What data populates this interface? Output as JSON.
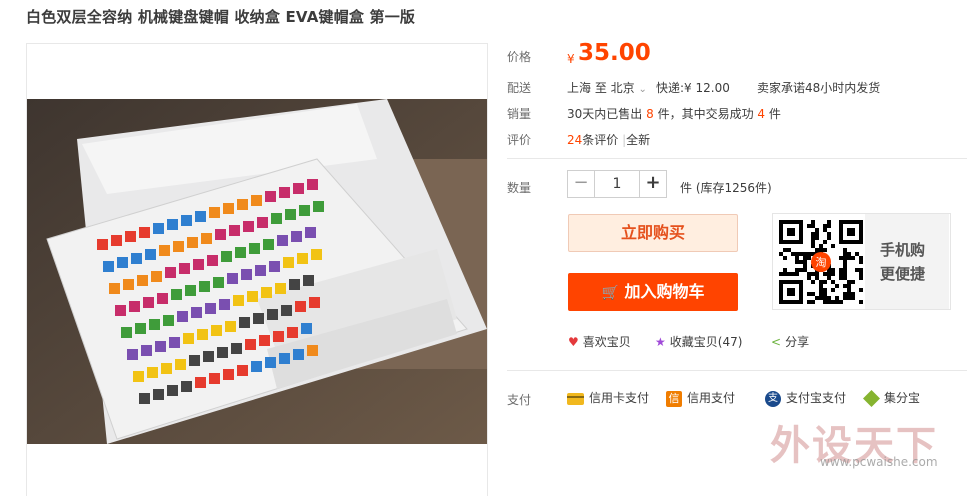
{
  "title": "白色双层全容纳 机械键盘键帽 收纳盒 EVA键帽盒 第一版",
  "price": {
    "label": "价格",
    "currency": "¥",
    "value": "35.00"
  },
  "delivery": {
    "label": "配送",
    "route": "上海 至 北京",
    "route_caret": "⌄",
    "shipping": "快递:¥ 12.00",
    "promise": "卖家承诺48小时内发货"
  },
  "sales": {
    "label": "销量",
    "prefix": "30天内已售出",
    "sold": "8",
    "mid": "件，其中交易成功",
    "success": "4",
    "suffix": "件"
  },
  "reviews": {
    "label": "评价",
    "count": "24",
    "count_suffix": "条评价",
    "divider": "|",
    "condition": "全新"
  },
  "quantity": {
    "label": "数量",
    "minus": "−",
    "value": "1",
    "plus": "+",
    "stock": "件 (库存1256件)"
  },
  "buttons": {
    "buy_now": "立即购买",
    "add_cart": "加入购物车",
    "cart_icon": "🛒"
  },
  "mobile": {
    "line1": "手机购",
    "line2": "更便捷",
    "qr_badge": "淘"
  },
  "actions": [
    {
      "name": "like",
      "icon": "♥",
      "icon_color": "#e4393c",
      "label": "喜欢宝贝"
    },
    {
      "name": "collect",
      "icon": "★",
      "icon_color": "#a04ad8",
      "label": "收藏宝贝(47)"
    },
    {
      "name": "share",
      "icon": "<",
      "icon_color": "#6cb33e",
      "label": "分享"
    }
  ],
  "payment": {
    "label": "支付",
    "items": [
      {
        "name": "credit-card",
        "label": "信用卡支付",
        "icon_color": "#f1b81e"
      },
      {
        "name": "xinyong",
        "label": "信用支付",
        "icon_color": "#f07d00",
        "icon_text": "信"
      },
      {
        "name": "alipay",
        "label": "支付宝支付",
        "icon_color": "#1a4a8c",
        "icon_text": "支"
      },
      {
        "name": "jifenbao",
        "label": "集分宝",
        "icon_color": "#86b430"
      }
    ]
  },
  "watermark": {
    "text": "外设天下",
    "url": "www.pcwaishe.com"
  }
}
